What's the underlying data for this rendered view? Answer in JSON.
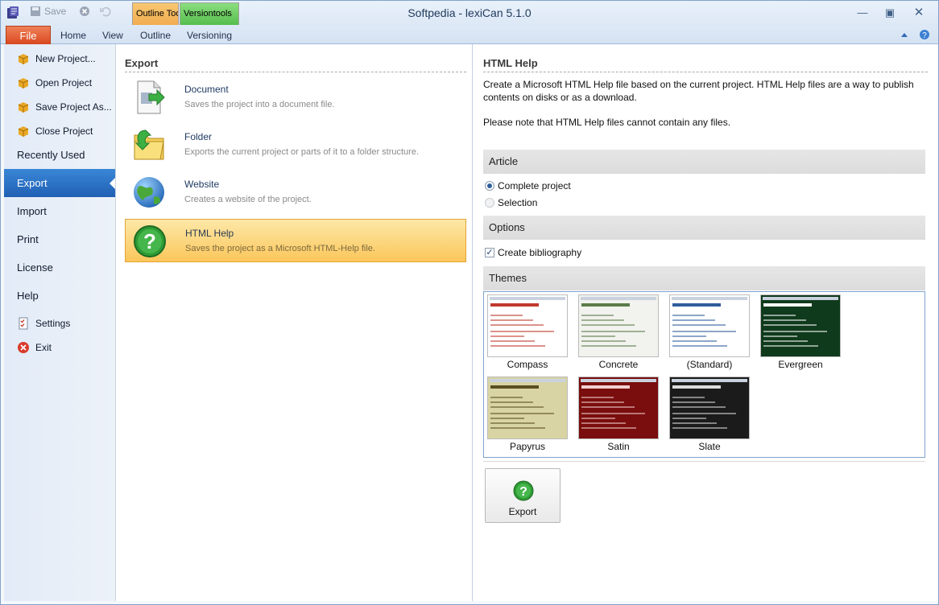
{
  "window": {
    "title": "Softpedia - lexiCan 5.1.0"
  },
  "quick_access": {
    "save_label": "Save"
  },
  "context_tabs": {
    "outline_tools": "Outline Too...",
    "version_tools": "Versiontools"
  },
  "ribbon_tabs": {
    "file": "File",
    "home": "Home",
    "view": "View",
    "outline": "Outline",
    "versioning": "Versioning"
  },
  "sidebar": {
    "items": [
      {
        "label": "New Project..."
      },
      {
        "label": "Open Project"
      },
      {
        "label": "Save Project As..."
      },
      {
        "label": "Close Project"
      },
      {
        "label": "Recently Used"
      },
      {
        "label": "Export"
      },
      {
        "label": "Import"
      },
      {
        "label": "Print"
      },
      {
        "label": "License"
      },
      {
        "label": "Help"
      },
      {
        "label": "Settings"
      },
      {
        "label": "Exit"
      }
    ]
  },
  "export_panel": {
    "title": "Export",
    "items": [
      {
        "title": "Document",
        "desc": "Saves the project into a document file."
      },
      {
        "title": "Folder",
        "desc": "Exports the current project or parts of it to a folder structure."
      },
      {
        "title": "Website",
        "desc": "Creates a website of the project."
      },
      {
        "title": "HTML Help",
        "desc": "Saves the project as a Microsoft HTML-Help file."
      }
    ]
  },
  "detail": {
    "title": "HTML Help",
    "description": "Create a Microsoft HTML Help file based on the current project. HTML Help files are a way to publish contents on disks or as a download.",
    "note": "Please note that HTML Help files cannot contain any files.",
    "article_header": "Article",
    "article_options": [
      {
        "label": "Complete project",
        "selected": true
      },
      {
        "label": "Selection",
        "selected": false
      }
    ],
    "options_header": "Options",
    "create_bibliography": {
      "label": "Create bibliography",
      "checked": true
    },
    "themes_header": "Themes",
    "themes": [
      {
        "name": "Compass",
        "bg": "#ffffff",
        "accent": "#c0392b"
      },
      {
        "name": "Concrete",
        "bg": "#f2f2ee",
        "accent": "#5b7c4a"
      },
      {
        "name": "(Standard)",
        "bg": "#ffffff",
        "accent": "#2f5d9a"
      },
      {
        "name": "Evergreen",
        "bg": "#0f3a1c",
        "accent": "#ffffff"
      },
      {
        "name": "Papyrus",
        "bg": "#d9d4a3",
        "accent": "#5a4f1e"
      },
      {
        "name": "Satin",
        "bg": "#7a0d0d",
        "accent": "#f2d0d0"
      },
      {
        "name": "Slate",
        "bg": "#1b1b1b",
        "accent": "#dcdcdc"
      }
    ],
    "export_button": "Export"
  }
}
